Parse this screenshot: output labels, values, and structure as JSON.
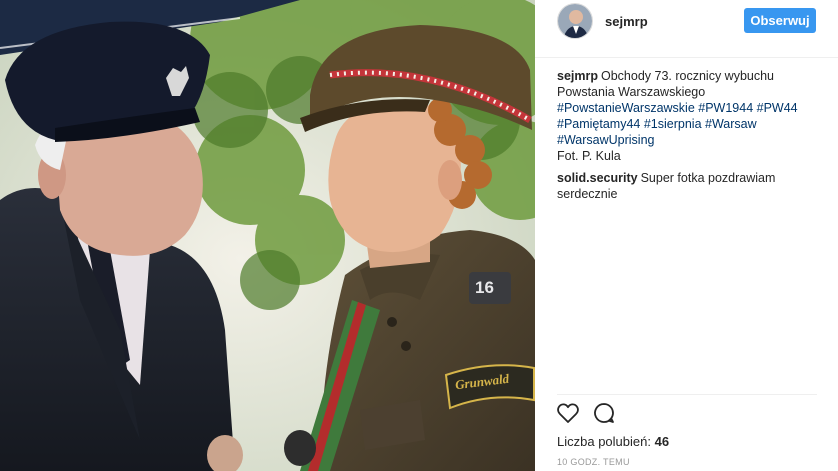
{
  "post": {
    "username": "sejmrp",
    "follow_label": "Obserwuj",
    "caption": {
      "user": "sejmrp",
      "lines": [
        "Obchody 73. rocznicy wybuchu",
        "Powstania Warszawskiego",
        " #PowstanieWarszawskie #PW1944  #PW44",
        "#Pamiętamy44 #1sierpnia #Warsaw",
        "#WarsawUprising",
        "Fot. P. Kula"
      ]
    },
    "comment": {
      "user": "solid.security",
      "lines": [
        "Super fotka pozdrawiam",
        "serdecznie"
      ]
    },
    "likes_label": "Liczba polubień:",
    "likes_count": "46",
    "timestamp": "10 GODZ. TEMU"
  },
  "photo": {
    "badge_number": "16",
    "patch_text": "Grunwald"
  },
  "icons": [
    "heart-icon",
    "comment-icon"
  ],
  "colors": {
    "follow_button": "#3897f0",
    "hashtag": "#003569",
    "timestamp": "#999999"
  }
}
